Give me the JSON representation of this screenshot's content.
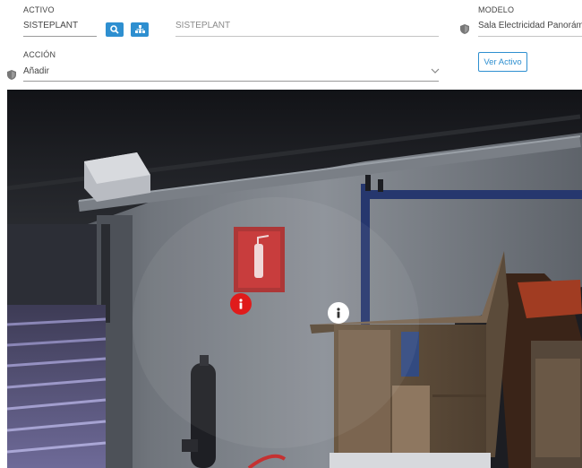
{
  "activo": {
    "label": "ACTIVO",
    "code": "SISTEPLANT",
    "name": "SISTEPLANT"
  },
  "modelo": {
    "label": "MODELO",
    "value": "Sala Electricidad Panorám"
  },
  "accion": {
    "label": "ACCIÓN",
    "selected": "Añadir"
  },
  "ver_activo_label": "Ver Activo",
  "colors": {
    "accent": "#2e8fd0",
    "hotspot_red": "#e01b1b",
    "hotspot_white": "#ffffff"
  },
  "icons": [
    "search-icon",
    "hierarchy-icon",
    "shield-icon",
    "chevron-down-icon",
    "info-icon"
  ]
}
